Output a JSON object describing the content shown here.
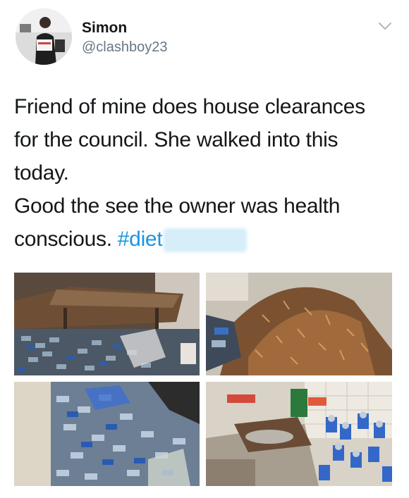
{
  "user": {
    "display_name": "Simon",
    "handle": "@clashboy23"
  },
  "tweet": {
    "lines": [
      "Friend of mine does house clearances",
      "for the council. She walked into this",
      "today.",
      "Good the see the owner was health",
      "conscious."
    ],
    "hashtag": "#diet"
  },
  "icons": {
    "menu": "chevron-down-icon"
  },
  "colors": {
    "hashtag": "#1b95e0",
    "handle": "#657786"
  }
}
